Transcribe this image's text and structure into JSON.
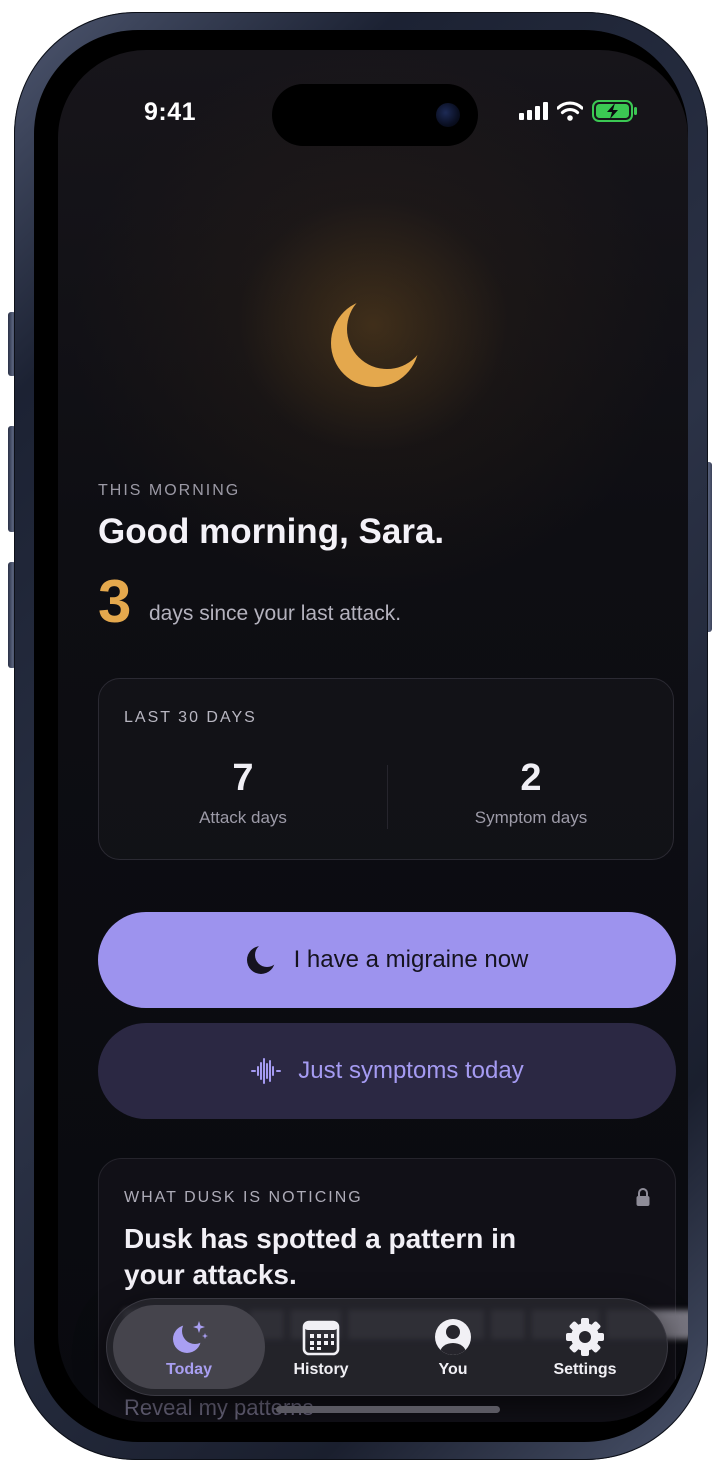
{
  "status_bar": {
    "time": "9:41",
    "icons": [
      "cellular-signal-icon",
      "wifi-icon",
      "battery-charging-icon"
    ],
    "battery_color": "#3bc853"
  },
  "hero": {
    "icon": "crescent-moon-icon",
    "icon_color": "#e4a84d"
  },
  "greeting": {
    "eyebrow": "THIS MORNING",
    "title": "Good morning, Sara.",
    "days_count": "3",
    "days_text": "days since your last attack."
  },
  "stats": {
    "label": "LAST 30 DAYS",
    "items": [
      {
        "value": "7",
        "caption": "Attack days"
      },
      {
        "value": "2",
        "caption": "Symptom days"
      }
    ]
  },
  "actions": {
    "primary_label": "I have a migraine now",
    "primary_icon": "crescent-moon-icon",
    "primary_color": "#9d93ee",
    "secondary_label": "Just symptoms today",
    "secondary_icon": "waveform-icon",
    "secondary_color": "#2b2843"
  },
  "insight": {
    "label": "WHAT DUSK IS NOTICING",
    "icon": "lock-icon",
    "title": "Dusk has spotted a pattern in your attacks.",
    "reveal_label": "Reveal my patterns"
  },
  "tabbar": {
    "tabs": [
      {
        "label": "Today",
        "icon": "moon-stars-icon",
        "active": true
      },
      {
        "label": "History",
        "icon": "calendar-icon",
        "active": false
      },
      {
        "label": "You",
        "icon": "person-circle-icon",
        "active": false
      },
      {
        "label": "Settings",
        "icon": "gear-icon",
        "active": false
      }
    ]
  },
  "colors": {
    "accent": "#9d93ee",
    "warm": "#e4a84d",
    "background": "#0b0b10"
  }
}
